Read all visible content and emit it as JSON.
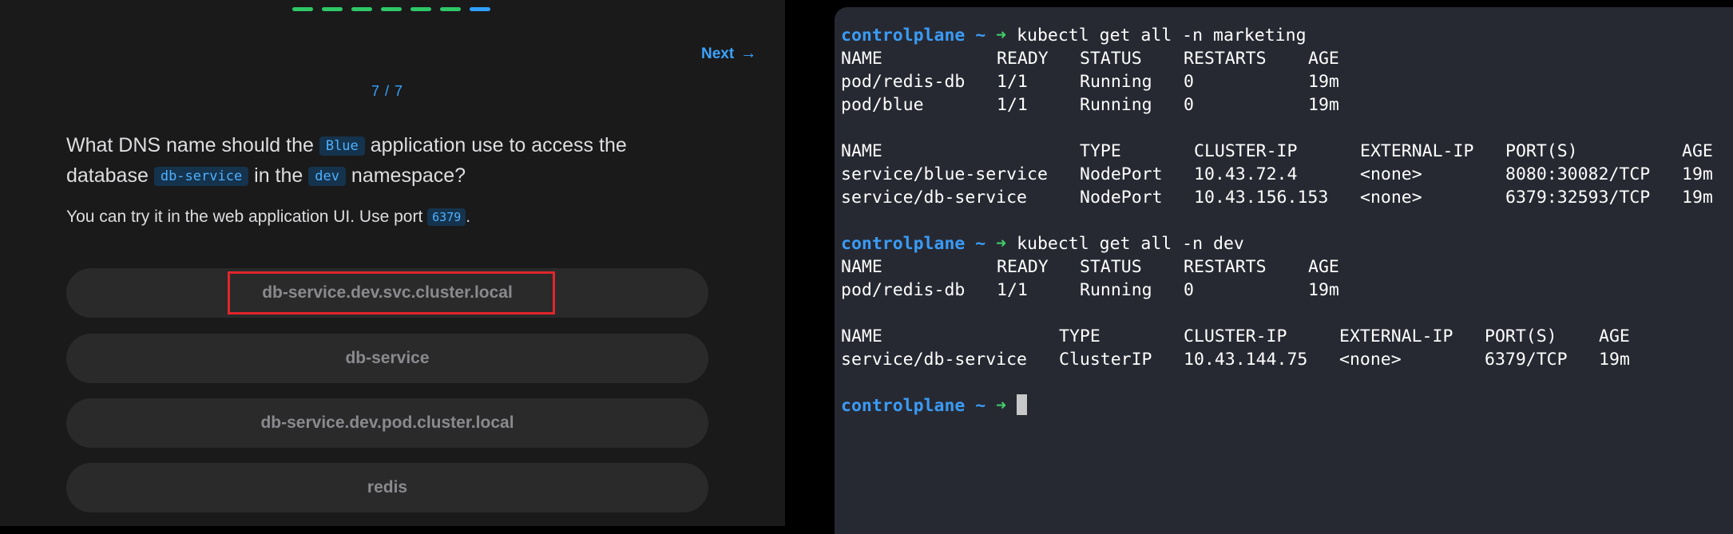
{
  "quiz": {
    "progress": {
      "total": 7,
      "current": 7
    },
    "next_label": "Next",
    "next_icon": "arrow-right-icon",
    "counter": "7 / 7",
    "question": {
      "part1": "What DNS name should the ",
      "code1": "Blue",
      "part2": " application use to access the database ",
      "code2": "db-service",
      "part3": " in the ",
      "code3": "dev",
      "part4": " namespace?"
    },
    "hint": {
      "part1": "You can try it in the web application UI. Use port ",
      "code": "6379",
      "part2": "."
    },
    "options": [
      "db-service.dev.svc.cluster.local",
      "db-service",
      "db-service.dev.pod.cluster.local",
      "redis"
    ],
    "highlight_color": "#e0262b"
  },
  "terminal": {
    "host": "controlplane ~",
    "arrow": "➜",
    "cmd1": "kubectl get all -n marketing",
    "pods1": {
      "headers": [
        "NAME",
        "READY",
        "STATUS",
        "RESTARTS",
        "AGE"
      ],
      "rows": [
        [
          "pod/redis-db",
          "1/1",
          "Running",
          "0",
          "19m"
        ],
        [
          "pod/blue",
          "1/1",
          "Running",
          "0",
          "19m"
        ]
      ]
    },
    "svc1": {
      "headers": [
        "NAME",
        "TYPE",
        "CLUSTER-IP",
        "EXTERNAL-IP",
        "PORT(S)",
        "AGE"
      ],
      "rows": [
        [
          "service/blue-service",
          "NodePort",
          "10.43.72.4",
          "<none>",
          "8080:30082/TCP",
          "19m"
        ],
        [
          "service/db-service",
          "NodePort",
          "10.43.156.153",
          "<none>",
          "6379:32593/TCP",
          "19m"
        ]
      ]
    },
    "cmd2": "kubectl get all -n dev",
    "pods2": {
      "headers": [
        "NAME",
        "READY",
        "STATUS",
        "RESTARTS",
        "AGE"
      ],
      "rows": [
        [
          "pod/redis-db",
          "1/1",
          "Running",
          "0",
          "19m"
        ]
      ]
    },
    "svc2": {
      "headers": [
        "NAME",
        "TYPE",
        "CLUSTER-IP",
        "EXTERNAL-IP",
        "PORT(S)",
        "AGE"
      ],
      "rows": [
        [
          "service/db-service",
          "ClusterIP",
          "10.43.144.75",
          "<none>",
          "6379/TCP",
          "19m"
        ]
      ]
    }
  }
}
